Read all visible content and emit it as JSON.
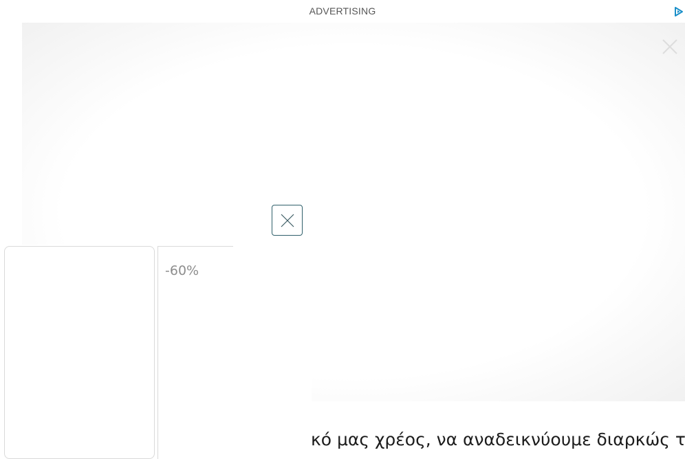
{
  "ad": {
    "label": "ADVERTISING",
    "adchoices_icon": "adchoices-triangle-icon",
    "close_icon": "close-x-icon",
    "placeholder_icon": "close-x-icon",
    "accent_color": "#1a8fc9",
    "placeholder_border_color": "#2e5f6a"
  },
  "product_strip": {
    "discount": "-60%"
  },
  "article": {
    "text": "κό μας χρέος, να αναδεικνύουμε διαρκώς τ"
  }
}
